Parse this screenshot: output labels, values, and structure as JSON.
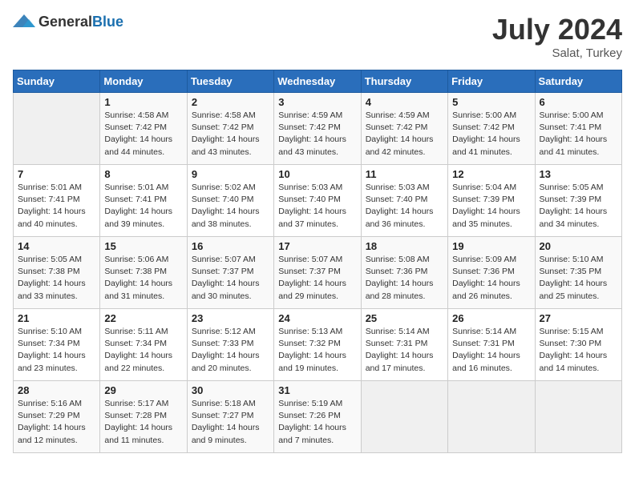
{
  "header": {
    "logo_general": "General",
    "logo_blue": "Blue",
    "month_year": "July 2024",
    "location": "Salat, Turkey"
  },
  "weekdays": [
    "Sunday",
    "Monday",
    "Tuesday",
    "Wednesday",
    "Thursday",
    "Friday",
    "Saturday"
  ],
  "weeks": [
    [
      {
        "day": "",
        "info": ""
      },
      {
        "day": "1",
        "info": "Sunrise: 4:58 AM\nSunset: 7:42 PM\nDaylight: 14 hours\nand 44 minutes."
      },
      {
        "day": "2",
        "info": "Sunrise: 4:58 AM\nSunset: 7:42 PM\nDaylight: 14 hours\nand 43 minutes."
      },
      {
        "day": "3",
        "info": "Sunrise: 4:59 AM\nSunset: 7:42 PM\nDaylight: 14 hours\nand 43 minutes."
      },
      {
        "day": "4",
        "info": "Sunrise: 4:59 AM\nSunset: 7:42 PM\nDaylight: 14 hours\nand 42 minutes."
      },
      {
        "day": "5",
        "info": "Sunrise: 5:00 AM\nSunset: 7:42 PM\nDaylight: 14 hours\nand 41 minutes."
      },
      {
        "day": "6",
        "info": "Sunrise: 5:00 AM\nSunset: 7:41 PM\nDaylight: 14 hours\nand 41 minutes."
      }
    ],
    [
      {
        "day": "7",
        "info": "Sunrise: 5:01 AM\nSunset: 7:41 PM\nDaylight: 14 hours\nand 40 minutes."
      },
      {
        "day": "8",
        "info": "Sunrise: 5:01 AM\nSunset: 7:41 PM\nDaylight: 14 hours\nand 39 minutes."
      },
      {
        "day": "9",
        "info": "Sunrise: 5:02 AM\nSunset: 7:40 PM\nDaylight: 14 hours\nand 38 minutes."
      },
      {
        "day": "10",
        "info": "Sunrise: 5:03 AM\nSunset: 7:40 PM\nDaylight: 14 hours\nand 37 minutes."
      },
      {
        "day": "11",
        "info": "Sunrise: 5:03 AM\nSunset: 7:40 PM\nDaylight: 14 hours\nand 36 minutes."
      },
      {
        "day": "12",
        "info": "Sunrise: 5:04 AM\nSunset: 7:39 PM\nDaylight: 14 hours\nand 35 minutes."
      },
      {
        "day": "13",
        "info": "Sunrise: 5:05 AM\nSunset: 7:39 PM\nDaylight: 14 hours\nand 34 minutes."
      }
    ],
    [
      {
        "day": "14",
        "info": "Sunrise: 5:05 AM\nSunset: 7:38 PM\nDaylight: 14 hours\nand 33 minutes."
      },
      {
        "day": "15",
        "info": "Sunrise: 5:06 AM\nSunset: 7:38 PM\nDaylight: 14 hours\nand 31 minutes."
      },
      {
        "day": "16",
        "info": "Sunrise: 5:07 AM\nSunset: 7:37 PM\nDaylight: 14 hours\nand 30 minutes."
      },
      {
        "day": "17",
        "info": "Sunrise: 5:07 AM\nSunset: 7:37 PM\nDaylight: 14 hours\nand 29 minutes."
      },
      {
        "day": "18",
        "info": "Sunrise: 5:08 AM\nSunset: 7:36 PM\nDaylight: 14 hours\nand 28 minutes."
      },
      {
        "day": "19",
        "info": "Sunrise: 5:09 AM\nSunset: 7:36 PM\nDaylight: 14 hours\nand 26 minutes."
      },
      {
        "day": "20",
        "info": "Sunrise: 5:10 AM\nSunset: 7:35 PM\nDaylight: 14 hours\nand 25 minutes."
      }
    ],
    [
      {
        "day": "21",
        "info": "Sunrise: 5:10 AM\nSunset: 7:34 PM\nDaylight: 14 hours\nand 23 minutes."
      },
      {
        "day": "22",
        "info": "Sunrise: 5:11 AM\nSunset: 7:34 PM\nDaylight: 14 hours\nand 22 minutes."
      },
      {
        "day": "23",
        "info": "Sunrise: 5:12 AM\nSunset: 7:33 PM\nDaylight: 14 hours\nand 20 minutes."
      },
      {
        "day": "24",
        "info": "Sunrise: 5:13 AM\nSunset: 7:32 PM\nDaylight: 14 hours\nand 19 minutes."
      },
      {
        "day": "25",
        "info": "Sunrise: 5:14 AM\nSunset: 7:31 PM\nDaylight: 14 hours\nand 17 minutes."
      },
      {
        "day": "26",
        "info": "Sunrise: 5:14 AM\nSunset: 7:31 PM\nDaylight: 14 hours\nand 16 minutes."
      },
      {
        "day": "27",
        "info": "Sunrise: 5:15 AM\nSunset: 7:30 PM\nDaylight: 14 hours\nand 14 minutes."
      }
    ],
    [
      {
        "day": "28",
        "info": "Sunrise: 5:16 AM\nSunset: 7:29 PM\nDaylight: 14 hours\nand 12 minutes."
      },
      {
        "day": "29",
        "info": "Sunrise: 5:17 AM\nSunset: 7:28 PM\nDaylight: 14 hours\nand 11 minutes."
      },
      {
        "day": "30",
        "info": "Sunrise: 5:18 AM\nSunset: 7:27 PM\nDaylight: 14 hours\nand 9 minutes."
      },
      {
        "day": "31",
        "info": "Sunrise: 5:19 AM\nSunset: 7:26 PM\nDaylight: 14 hours\nand 7 minutes."
      },
      {
        "day": "",
        "info": ""
      },
      {
        "day": "",
        "info": ""
      },
      {
        "day": "",
        "info": ""
      }
    ]
  ]
}
